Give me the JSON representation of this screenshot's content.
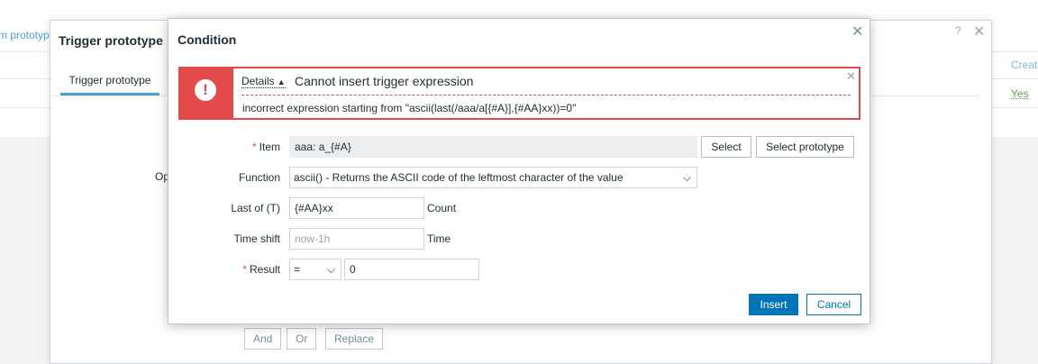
{
  "background": {
    "breadcrumb": "m prototype",
    "create_link": "Creat",
    "yes_link": "Yes"
  },
  "trigger_dialog": {
    "title": "Trigger prototype",
    "help_icon": "?",
    "close_icon": "✕",
    "tab": "Trigger prototype",
    "op_label": "Op",
    "buttons": {
      "and": "And",
      "or": "Or",
      "replace": "Replace"
    }
  },
  "condition_dialog": {
    "title": "Condition",
    "close_icon": "✕",
    "error": {
      "icon": "!",
      "details_label": "Details",
      "details_arrow": "▲",
      "title": "Cannot insert trigger expression",
      "text": "incorrect expression starting from \"ascii(last(/aaa/a[{#A}],{#AA}xx))=0\"",
      "close_icon": "✕"
    },
    "form": {
      "item": {
        "label": "Item",
        "required": "*",
        "value": "aaa: a_{#A}",
        "select_button": "Select",
        "select_prototype_button": "Select prototype"
      },
      "function": {
        "label": "Function",
        "value": "ascii() - Returns the ASCII code of the leftmost character of the value"
      },
      "last_of": {
        "label": "Last of (T)",
        "value": "{#AA}xx",
        "suffix": "Count"
      },
      "time_shift": {
        "label": "Time shift",
        "value": "",
        "placeholder": "now-1h",
        "suffix": "Time"
      },
      "result": {
        "label": "Result",
        "required": "*",
        "operator": "=",
        "value": "0"
      }
    },
    "insert_button": "Insert",
    "cancel_button": "Cancel"
  },
  "colors": {
    "error": "#e34a4a",
    "primary": "#0275b8",
    "link": "#4d9fd7"
  }
}
